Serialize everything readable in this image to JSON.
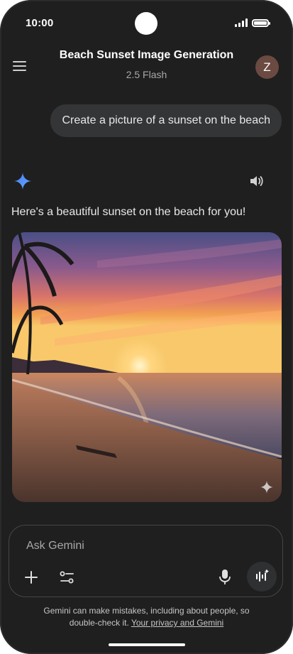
{
  "status_bar": {
    "time": "10:00"
  },
  "header": {
    "title": "Beach Sunset Image Generation",
    "model": "2.5 Flash",
    "avatar_letter": "Z"
  },
  "conversation": {
    "user_prompt": "Create a picture of a sunset on the beach",
    "assistant_reply": "Here's a beautiful sunset on the beach for you!"
  },
  "composer": {
    "placeholder": "Ask Gemini"
  },
  "footer": {
    "disclaimer_line1": "Gemini can make mistakes, including about people, so",
    "disclaimer_line2": "double-check it.",
    "privacy_link": "Your privacy and Gemini"
  },
  "icons": {
    "menu": "menu-icon",
    "gemini": "gemini-sparkle-icon",
    "speaker": "speaker-icon",
    "plus": "plus-icon",
    "tools": "tools-icon",
    "mic": "mic-icon",
    "live": "live-icon"
  },
  "colors": {
    "background": "#1f1f1f",
    "bubble": "#333537",
    "avatar": "#6b4a42",
    "gemini_blue": "#4c8df6"
  }
}
